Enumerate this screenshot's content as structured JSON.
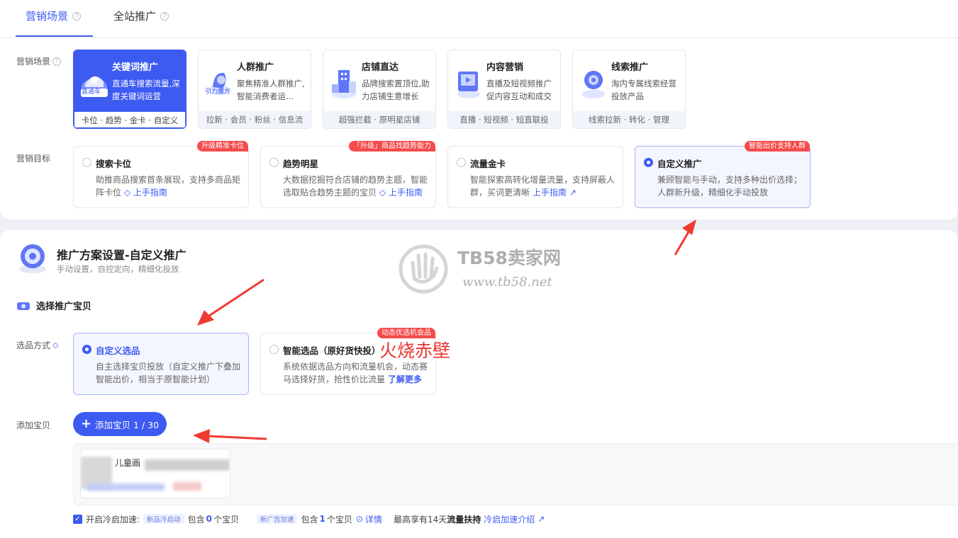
{
  "tabs": [
    {
      "label": "营销场景",
      "active": true
    },
    {
      "label": "全站推广",
      "active": false
    }
  ],
  "scene_row": {
    "label": "营销场景",
    "items": [
      {
        "title": "关键词推广",
        "desc": "直通车搜索流量,深度关键词运营",
        "foot": "卡位 · 趋势 · 金卡 · 自定义",
        "ill_label": "直通车",
        "selected": true
      },
      {
        "title": "人群推广",
        "desc": "聚焦精准人群推广,智能消费者运...",
        "foot": "拉新 · 会员 · 粉丝 · 信息流",
        "ill_label": "引力魔方",
        "selected": false
      },
      {
        "title": "店铺直达",
        "desc": "品牌搜索置顶位,助力店铺生意增长",
        "foot": "超强拦截 · 原明星店铺",
        "selected": false
      },
      {
        "title": "内容营销",
        "desc": "直播及短视频推广促内容互动和成交",
        "foot": "直播 · 短视频 · 短直联投",
        "selected": false
      },
      {
        "title": "线索推广",
        "desc": "淘内专属线索经营投放产品",
        "foot": "线索拉新 · 转化 · 管理",
        "selected": false
      }
    ]
  },
  "goal_row": {
    "label": "营销目标",
    "items": [
      {
        "title": "搜索卡位",
        "desc": "助推商品搜索首条展现，支持多商品矩阵卡位",
        "link": "上手指南",
        "badge": "升级精准卡位",
        "selected": false
      },
      {
        "title": "趋势明星",
        "desc": "大数据挖掘符合店铺的趋势主题，智能选取贴合趋势主题的宝贝",
        "link": "上手指南",
        "badge": "「升级」商品找趋势能力",
        "selected": false
      },
      {
        "title": "流量金卡",
        "desc": "智能探索高转化增量流量，支持屏蔽人群，买词更清晰",
        "link": "上手指南",
        "badge": "",
        "selected": false
      },
      {
        "title": "自定义推广",
        "desc": "兼顾智能与手动，支持多种出价选择；人群新升级，精细化手动投放",
        "link": "",
        "badge": "智能出价支持人群",
        "selected": true
      }
    ]
  },
  "plan": {
    "title": "推广方案设置-自定义推广",
    "subtitle": "手动设置，自控定向，精细化投放"
  },
  "section": {
    "title": "选择推广宝贝"
  },
  "pick_row": {
    "label": "选品方式",
    "items": [
      {
        "title": "自定义选品",
        "desc": "自主选择宝贝投放（自定义推广下叠加智能出价，相当于原智能计划）",
        "link": "",
        "badge": "",
        "selected": true
      },
      {
        "title": "智能选品（原好货快投）",
        "desc": "系统依据选品方向和流量机会，动态赛马选择好货，抢性价比流量",
        "link": "了解更多",
        "badge": "动态优选机会品",
        "selected": false
      }
    ]
  },
  "add_row": {
    "label": "添加宝贝",
    "button": "添加宝贝 1 / 30",
    "item_name": "儿童画"
  },
  "cold_start": {
    "label": "开启冷启加速:",
    "tag1": "新品冷启动",
    "count1_prefix": "包含",
    "count1": "0",
    "count1_suffix": "个宝贝",
    "tag2": "新广告加速",
    "count2_prefix": "包含",
    "count2": "1",
    "count2_suffix": "个宝贝",
    "detail": "详情",
    "note_prefix": "最高享有14天",
    "note_strong": "流量扶持",
    "intro_link": "冷启加速介绍"
  },
  "watermark": {
    "brand": "TB58卖家网",
    "url": "www.tb58.net",
    "overlay": "火烧赤壁"
  },
  "colors": {
    "accent": "#3d5af1",
    "badge": "#f54b4b"
  }
}
